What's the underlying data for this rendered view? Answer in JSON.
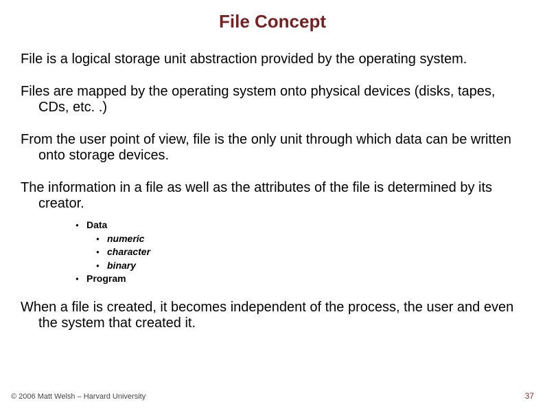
{
  "title": "File Concept",
  "paragraphs": {
    "p1": "File is a logical storage unit abstraction provided by the operating system.",
    "p2": "Files are mapped by the operating system onto physical devices (disks, tapes, CDs, etc. .)",
    "p3": "From the user point of view, file is the only unit through which data can be written onto storage devices.",
    "p4": "The information in a file as well as the attributes of the file is determined by its creator.",
    "p5": "When a file is created, it becomes independent of the process, the user and even the system that created it."
  },
  "bullets": {
    "data_label": "Data",
    "sub1": "numeric",
    "sub2": "character",
    "sub3": "binary",
    "program_label": "Program"
  },
  "footer": {
    "copyright": "© 2006 Matt Welsh – Harvard University",
    "page": "37"
  }
}
